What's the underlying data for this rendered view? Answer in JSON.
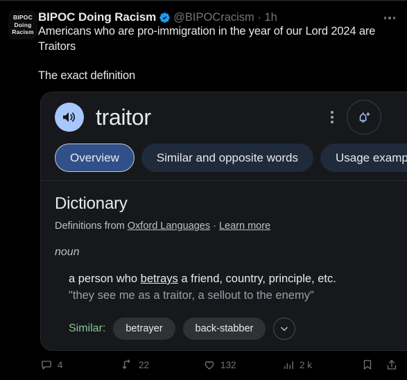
{
  "tweet": {
    "avatar_lines": [
      "BIPOC",
      "Doing",
      "Racism"
    ],
    "avatar_name": "avatar",
    "display_name": "BIPOC Doing Racism",
    "verified_icon": "verified-badge-icon",
    "handle": "@BIPOCracism · 1h",
    "more_icon": "more-horizontal-icon",
    "body_line1": "Americans who are pro-immigration in the year of our Lord 2024 are Traitors",
    "body_line2": "The exact definition"
  },
  "card": {
    "speaker_icon": "speaker-volume-icon",
    "word": "traitor",
    "more_icon": "more-vertical-icon",
    "bell_icon": "bell-add-icon",
    "tabs": [
      {
        "label": "Overview",
        "active": true
      },
      {
        "label": "Similar and opposite words",
        "active": false
      },
      {
        "label": "Usage examples",
        "active": false
      }
    ],
    "section_title": "Dictionary",
    "source_prefix": "Definitions from ",
    "source_link": "Oxford Languages",
    "source_separator": " · ",
    "learn_more": "Learn more",
    "part_of_speech": "noun",
    "definition_pre": "a person who ",
    "definition_link": "betrays",
    "definition_post": " a friend, country, principle, etc.",
    "example": "\"they see me as a traitor, a sellout to the enemy\"",
    "similar_label": "Similar:",
    "similar_chips": [
      "betrayer",
      "back-stabber"
    ],
    "expand_icon": "chevron-down-icon"
  },
  "actions": {
    "reply": {
      "icon": "reply-icon",
      "count": "4"
    },
    "retweet": {
      "icon": "retweet-icon",
      "count": "22"
    },
    "like": {
      "icon": "heart-icon",
      "count": "132"
    },
    "views": {
      "icon": "views-bar-icon",
      "count": "2 k"
    },
    "bookmark": {
      "icon": "bookmark-icon",
      "count": ""
    },
    "share": {
      "icon": "share-upload-icon",
      "count": ""
    }
  },
  "colors": {
    "page_bg": "#000000",
    "card_bg": "#17181c",
    "accent_blue": "#1d9bf0",
    "tab_active": "#31508a",
    "speaker_bg": "#a8c7fa",
    "similar_green": "#81c995",
    "muted": "#71767b"
  }
}
